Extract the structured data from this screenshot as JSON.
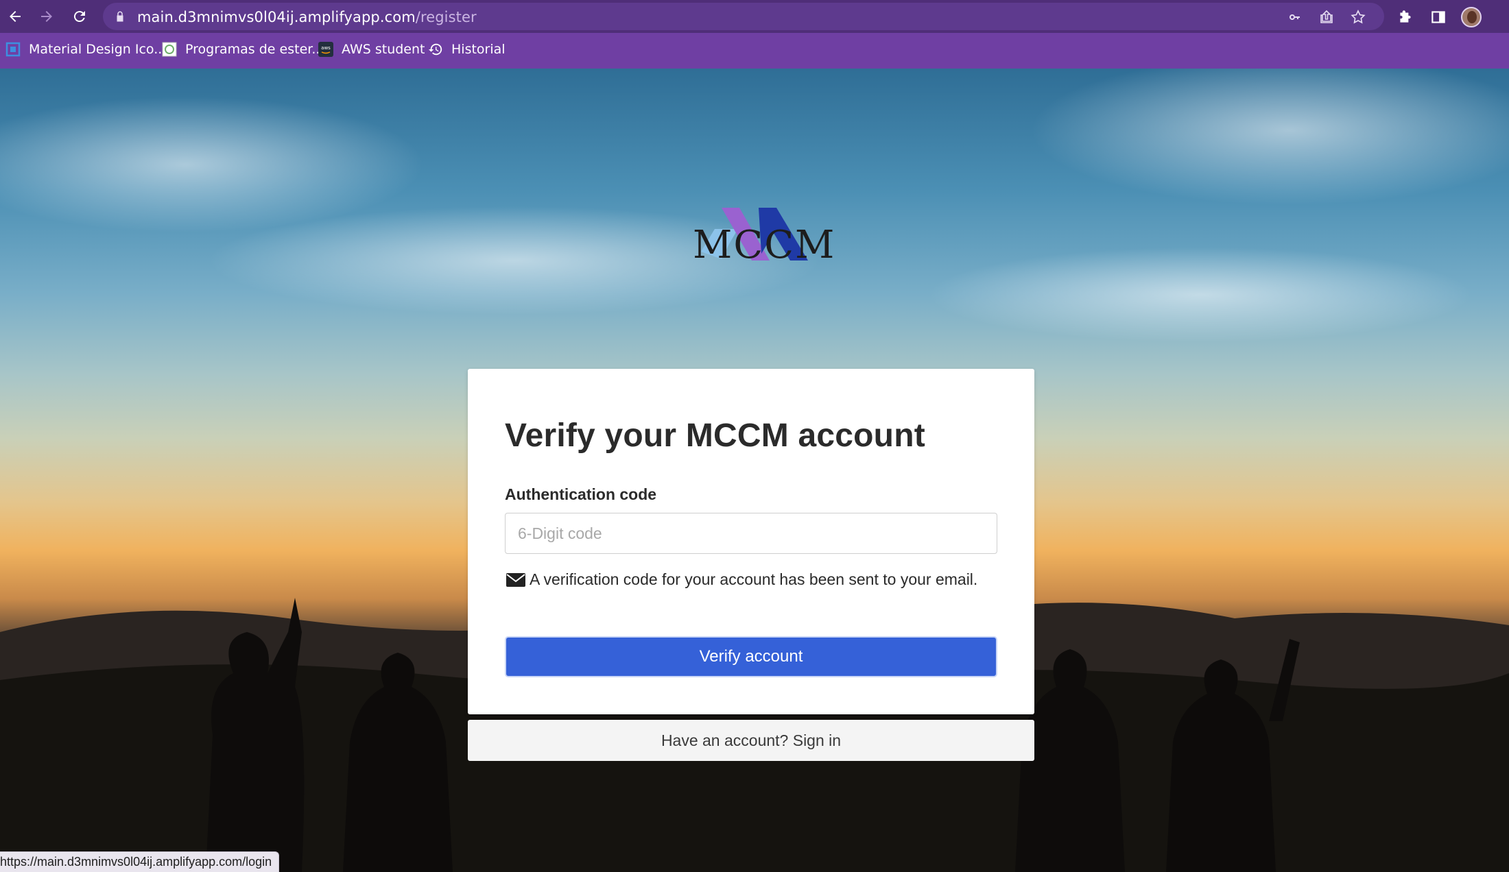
{
  "browser": {
    "url_host": "main.d3mnimvs0l04ij.amplifyapp.com",
    "url_path": "/register",
    "bookmarks": [
      {
        "label": "Material Design Ico...",
        "icon": "material-design-icon"
      },
      {
        "label": "Programas de ester...",
        "icon": "site-favicon-icon"
      },
      {
        "label": "AWS student",
        "icon": "aws-icon"
      },
      {
        "label": "Historial",
        "icon": "history-icon"
      }
    ],
    "status_url": "https://main.d3mnimvs0l04ij.amplifyapp.com/login",
    "colors": {
      "toolbar": "#4f2e78",
      "bookmarks_bar": "#6f3fa3"
    }
  },
  "brand": {
    "name": "MCCM",
    "colors": {
      "light_blue": "#8cc3ea",
      "purple": "#9a62d0",
      "dark_blue": "#1f3aa6"
    }
  },
  "form": {
    "title": "Verify your MCCM account",
    "code_label": "Authentication code",
    "code_placeholder": "6-Digit code",
    "code_value": "",
    "hint": "A verification code for your account has been sent to your email.",
    "submit_label": "Verify account",
    "signin_text": "Have an account? Sign in",
    "accent_color": "#3561d8"
  }
}
